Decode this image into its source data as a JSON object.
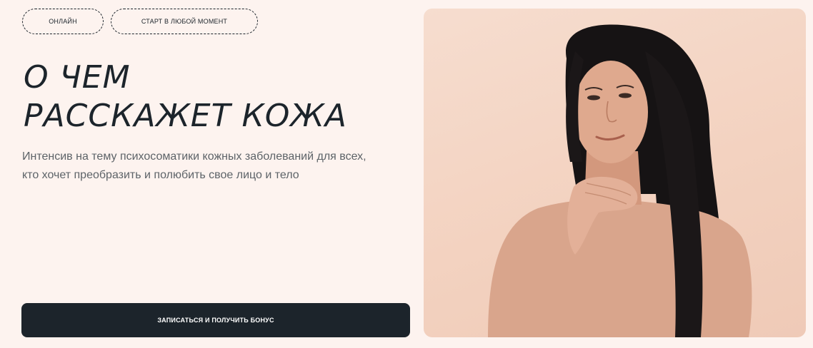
{
  "tags": [
    "ОНЛАЙН",
    "СТАРТ В ЛЮБОЙ МОМЕНТ"
  ],
  "hero": {
    "title_lines": [
      "О ЧЕМ",
      "РАССКАЖЕТ КОЖА"
    ],
    "subtitle_lines": [
      "Интенсив на тему психосоматики кожных заболеваний для всех,",
      "кто хочет преобразить и полюбить свое лицо и тело"
    ],
    "cta_label": "ЗАПИСАТЬСЯ И ПОЛУЧИТЬ БОНУС"
  },
  "colors": {
    "background": "#fdf3ef",
    "text_dark": "#1c242b",
    "subtitle_text": "#5d6368",
    "button_bg": "#1c242b",
    "button_text": "#ffffff"
  }
}
